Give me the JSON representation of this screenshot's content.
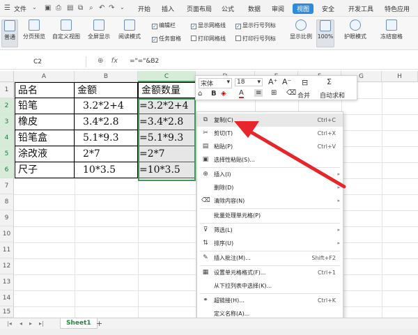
{
  "menubar": {
    "menu_label": "文件",
    "tabs": [
      "开始",
      "插入",
      "页面布局",
      "公式",
      "数据",
      "审阅",
      "视图",
      "安全",
      "开发工具",
      "特色应用"
    ],
    "active_tab": "视图"
  },
  "ribbon": {
    "normal": "普通",
    "page_break": "分页预览",
    "custom_view": "自定义视图",
    "fullscreen": "全屏显示",
    "reading_mode": "阅读模式",
    "edit_bar": "编辑栏",
    "task_pane": "任务窗格",
    "show_gridlines": "显示网格线",
    "print_gridlines": "打印网格线",
    "show_row_col": "显示行号列标",
    "print_row_col": "打印行号列标",
    "zoom": "显示比例",
    "zoom_100": "100%",
    "eye_protect": "护眼模式",
    "freeze": "冻结窗格"
  },
  "formula_bar": {
    "cell_ref": "C2",
    "formula": "=\"=\"&B2"
  },
  "columns": [
    "A",
    "B",
    "C",
    "D",
    "E",
    "F",
    "G",
    "H"
  ],
  "rows": [
    "1",
    "2",
    "3",
    "4",
    "5",
    "6",
    "7",
    "8",
    "9",
    "10",
    "11",
    "12",
    "13",
    "14",
    "15",
    "16",
    "17",
    "18"
  ],
  "table": {
    "headers": [
      "品名",
      "金额",
      "金额数量"
    ],
    "rows": [
      [
        "铅笔",
        "3.2*2+4",
        "=3.2*2+4"
      ],
      [
        "橡皮",
        "3.4*2.8",
        "=3.4*2.8"
      ],
      [
        "铅笔盒",
        "5.1*9.3",
        "=5.1*9.3"
      ],
      [
        "涂改液",
        "2*7",
        "=2*7"
      ],
      [
        "尺子",
        "10*3.5",
        "=10*3.5"
      ]
    ]
  },
  "mini_toolbar": {
    "font": "宋体",
    "size": "18",
    "merge": "合并",
    "autosum": "自动求和"
  },
  "context_menu": {
    "items": [
      {
        "icon": "copy-icon",
        "label": "复制(C)",
        "shortcut": "Ctrl+C",
        "submenu": false
      },
      {
        "icon": "cut-icon",
        "label": "剪切(T)",
        "shortcut": "Ctrl+X",
        "submenu": false
      },
      {
        "icon": "paste-icon",
        "label": "粘贴(P)",
        "shortcut": "Ctrl+V",
        "submenu": false
      },
      {
        "icon": "paste-special-icon",
        "label": "选择性粘贴(S)...",
        "shortcut": "",
        "submenu": false
      },
      {
        "icon": "insert-icon",
        "label": "插入(I)",
        "shortcut": "",
        "submenu": true
      },
      {
        "icon": "",
        "label": "删除(D)",
        "shortcut": "",
        "submenu": true
      },
      {
        "icon": "clear-icon",
        "label": "清除内容(N)",
        "shortcut": "",
        "submenu": true
      },
      {
        "icon": "",
        "label": "批量处理单元格(P)",
        "shortcut": "",
        "submenu": false
      },
      {
        "icon": "filter-icon",
        "label": "筛选(L)",
        "shortcut": "",
        "submenu": true
      },
      {
        "icon": "sort-icon",
        "label": "排序(U)",
        "shortcut": "",
        "submenu": true
      },
      {
        "icon": "comment-icon",
        "label": "插入批注(M)...",
        "shortcut": "Shift+F2",
        "submenu": false
      },
      {
        "icon": "format-cells-icon",
        "label": "设置单元格格式(F)...",
        "shortcut": "Ctrl+1",
        "submenu": false
      },
      {
        "icon": "",
        "label": "从下拉列表中选择(K)...",
        "shortcut": "",
        "submenu": false
      },
      {
        "icon": "hyperlink-icon",
        "label": "超链接(H)...",
        "shortcut": "Ctrl+K",
        "submenu": false
      },
      {
        "icon": "",
        "label": "定义名称(A)...",
        "shortcut": "",
        "submenu": false
      }
    ]
  },
  "sheet_tab": "Sheet1",
  "accent_color": "#2e8bdc",
  "arrow_color": "#e8252b"
}
